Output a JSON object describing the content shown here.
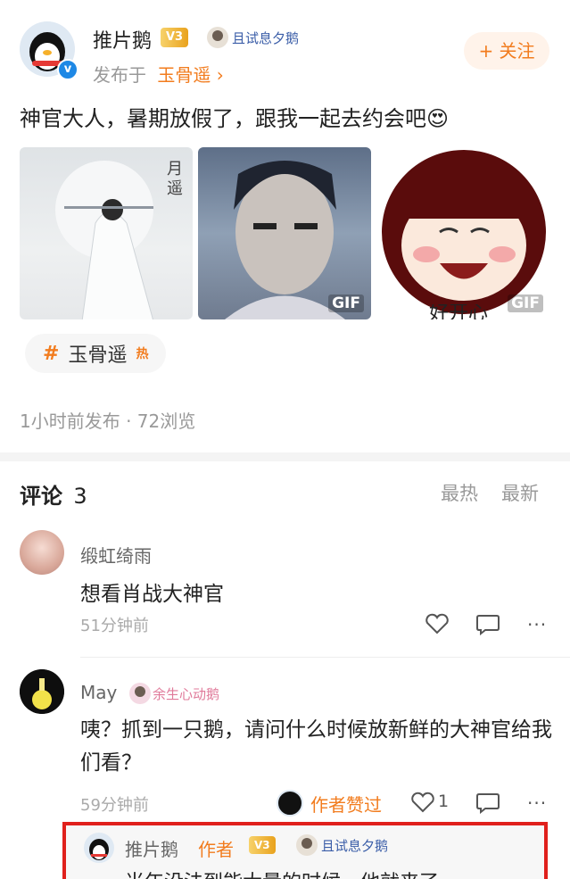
{
  "post": {
    "author_name": "推片鹅",
    "level_badge": "V3",
    "fan_badge_label": "且试息夕鹅",
    "posted_in_prefix": "发布于",
    "posted_in_topic": "玉骨遥",
    "follow_label": "+ 关注",
    "text": "神官大人，暑期放假了，跟我一起去约会吧",
    "emoji": "😍",
    "images": [
      {
        "name": "poster-image",
        "overlay_text": "",
        "gif": false
      },
      {
        "name": "portrait-gif",
        "overlay_text": "",
        "gif": true,
        "gif_label": "GIF"
      },
      {
        "name": "meme-gif",
        "overlay_text": "好开心",
        "gif": true,
        "gif_label": "GIF"
      }
    ],
    "topic_tag_hash": "#",
    "topic_tag_label": "玉骨遥",
    "topic_hot_label": "热",
    "meta": "1小时前发布 · 72浏览"
  },
  "comments_header": {
    "title": "评论",
    "count": "3",
    "sort_hot": "最热",
    "sort_new": "最新"
  },
  "comments": [
    {
      "name": "缎虹绮雨",
      "badge": "",
      "text": "想看肖战大神官",
      "time": "51分钟前",
      "like_count": ""
    },
    {
      "name": "May",
      "badge": "余生心动鹅",
      "text": "咦？抓到一只鹅，请问什么时候放新鲜的大神官给我们看？",
      "time": "59分钟前",
      "author_liked": "作者赞过",
      "like_count": "1"
    }
  ],
  "reply": {
    "name": "推片鹅",
    "author_tag": "作者",
    "level_badge": "V3",
    "fan_badge_label": "且试息夕鹅",
    "text": "当年没法到能大量的时候，他就来了"
  },
  "colors": {
    "accent_orange": "#f27c1e",
    "link_blue": "#3b5ea8",
    "highlight_red": "#e0201c"
  }
}
